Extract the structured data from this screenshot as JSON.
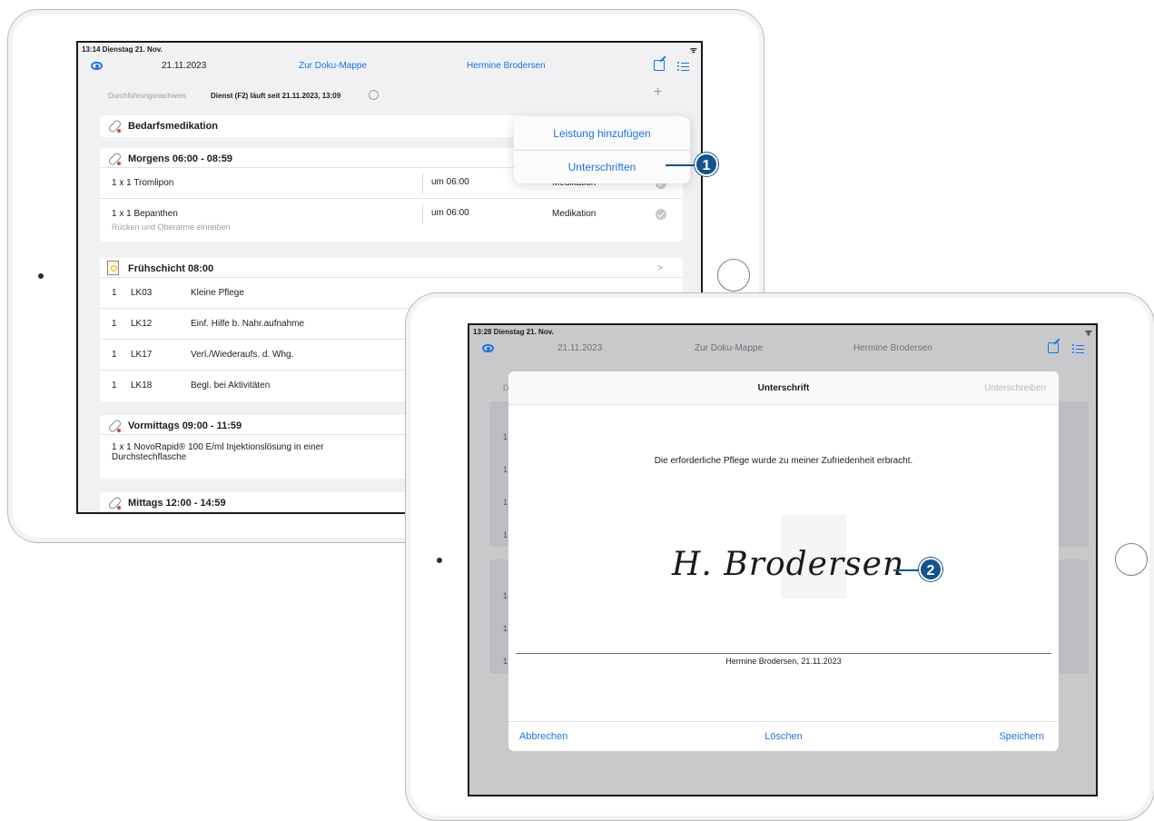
{
  "ipad1": {
    "status": {
      "time_date": "13:14  Dienstag 21. Nov.",
      "wifi": "wifi"
    },
    "nav": {
      "date": "21.11.2023",
      "doku": "Zur Doku-Mappe",
      "patient": "Hermine Brodersen"
    },
    "info": {
      "label": "Durchführungsnachweis",
      "dienst": "Dienst (F2) läuft seit 21.11.2023, 13:09"
    },
    "plus": "+",
    "popover": {
      "item1": "Leistung hinzufügen",
      "item2": "Unterschriften"
    },
    "sections": {
      "bedarf": "Bedarfsmedikation",
      "morgens": {
        "title": "Morgens 06:00 - 08:59",
        "rows": [
          {
            "name": "1 x 1 Tromlipon",
            "time": "um 06:00",
            "kind": "Medikation",
            "sub": ""
          },
          {
            "name": "1 x 1 Bepanthen",
            "time": "um 06:00",
            "kind": "Medikation",
            "sub": "Rücken und Oberarme einreiben"
          }
        ]
      },
      "frueh": {
        "title": "Frühschicht 08:00",
        "chevron": ">",
        "rows": [
          {
            "qty": "1",
            "code": "LK03",
            "name": "Kleine Pflege"
          },
          {
            "qty": "1",
            "code": "LK12",
            "name": "Einf. Hilfe b. Nahr.aufnahme"
          },
          {
            "qty": "1",
            "code": "LK17",
            "name": "Verl./Wiederaufs. d. Whg."
          },
          {
            "qty": "1",
            "code": "LK18",
            "name": "Begl. bei Aktivitäten"
          }
        ]
      },
      "vormittags": {
        "title": "Vormittags 09:00 - 11:59",
        "row1": "1 x 1 NovoRapid® 100 E/ml Injektionslösung in einer",
        "row2": "Durchstechflasche"
      },
      "mittags": "Mittags 12:00 - 14:59"
    }
  },
  "ipad2": {
    "status": {
      "time_date": "13:28  Dienstag 21. Nov."
    },
    "nav": {
      "date": "21.11.2023",
      "doku": "Zur Doku-Mappe",
      "patient": "Hermine Brodersen"
    },
    "bg_letter": "D",
    "bg_qty": "1",
    "modal": {
      "title": "Unterschrift",
      "sign": "Unterschreiben",
      "statement": "Die erforderliche Pflege wurde zu meiner Zufriedenheit erbracht.",
      "signature": "H. Brodersen",
      "signer": "Hermine Brodersen, 21.11.2023",
      "cancel": "Abbrechen",
      "delete": "Löschen",
      "save": "Speichern"
    }
  },
  "callouts": {
    "one": "1",
    "two": "2"
  },
  "colors": {
    "accent": "#1a73e8",
    "badge": "#14538e"
  }
}
